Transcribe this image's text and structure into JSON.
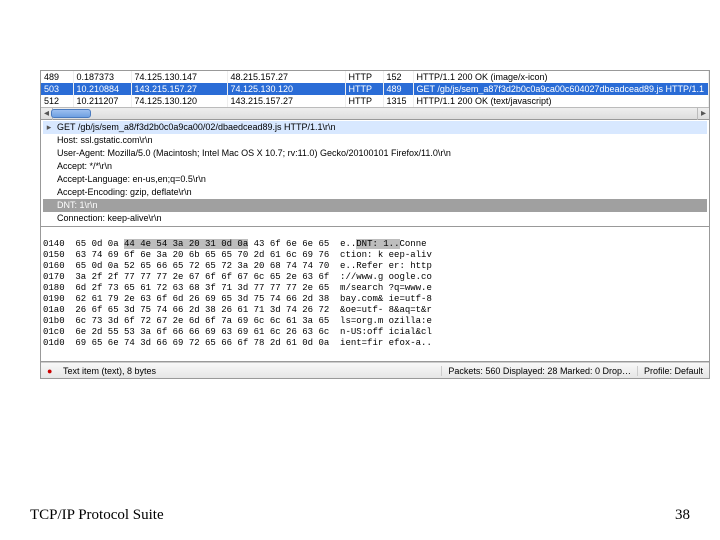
{
  "packets": [
    {
      "no": "489",
      "time": "0.187373",
      "src": "74.125.130.147",
      "dst": "48.215.157.27",
      "proto": "HTTP",
      "len": "152",
      "info": "HTTP/1.1 200 OK  (image/x-icon)"
    },
    {
      "no": "503",
      "time": "10.210884",
      "src": "143.215.157.27",
      "dst": "74.125.130.120",
      "proto": "HTTP",
      "len": "489",
      "info": "GET /gb/js/sem_a87f3d2b0c0a9ca00c604027dbeadcead89.js HTTP/1.1"
    },
    {
      "no": "512",
      "time": "10.211207",
      "src": "74.125.130.120",
      "dst": "143.215.157.27",
      "proto": "HTTP",
      "len": "1315",
      "info": "HTTP/1.1 200 OK  (text/javascript)"
    }
  ],
  "details": {
    "get": "GET /gb/js/sem_a8/f3d2b0c0a9ca00/02/dbaedcead89.js HTTP/1.1\\r\\n",
    "host": "Host: ssl.gstatic.com\\r\\n",
    "ua": "User-Agent: Mozilla/5.0 (Macintosh; Intel Mac OS X 10.7; rv:11.0) Gecko/20100101 Firefox/11.0\\r\\n",
    "accept": "Accept: */*\\r\\n",
    "acceptlang": "Accept-Language: en-us,en;q=0.5\\r\\n",
    "acceptenc": "Accept-Encoding: gzip, deflate\\r\\n",
    "dnt": "DNT: 1\\r\\n",
    "conn": "Connection: keep-alive\\r\\n"
  },
  "hex": [
    "0140  65 0d 0a ** ** ** ** ** ** ** ** 43 6f 6e 6e 65  e..** ** ** Conne",
    "0150  63 74 69 6f 6e 3a 20 6b 65 65 70 2d 61 6c 69 76  ction: k eep-aliv",
    "0160  65 0d 0a 52 65 66 65 72 65 72 3a 20 68 74 74 70  e..Refer er: http",
    "0170  3a 2f 2f 77 77 77 2e 67 6f 6f 67 6c 65 2e 63 6f  ://www.g oogle.co",
    "0180  6d 2f 73 65 61 72 63 68 3f 71 3d 77 77 77 2e 65  m/search ?q=www.e",
    "0190  62 61 79 2e 63 6f 6d 26 69 65 3d 75 74 66 2d 38  bay.com& ie=utf-8",
    "01a0  26 6f 65 3d 75 74 66 2d 38 26 61 71 3d 74 26 72  &oe=utf- 8&aq=t&r",
    "01b0  6c 73 3d 6f 72 67 2e 6d 6f 7a 69 6c 6c 61 3a 65  ls=org.m ozilla:e",
    "01c0  6e 2d 55 53 3a 6f 66 66 69 63 69 61 6c 26 63 6c  n-US:off icial&cl",
    "01d0  69 65 6e 74 3d 66 69 72 65 66 6f 78 2d 61 0d 0a  ient=fir efox-a.."
  ],
  "status": {
    "left": "Text item (text), 8 bytes",
    "mid": "Packets: 560 Displayed: 28 Marked: 0 Drop…",
    "right": "Profile: Default"
  },
  "slide": {
    "title": "TCP/IP Protocol Suite",
    "page": "38"
  }
}
